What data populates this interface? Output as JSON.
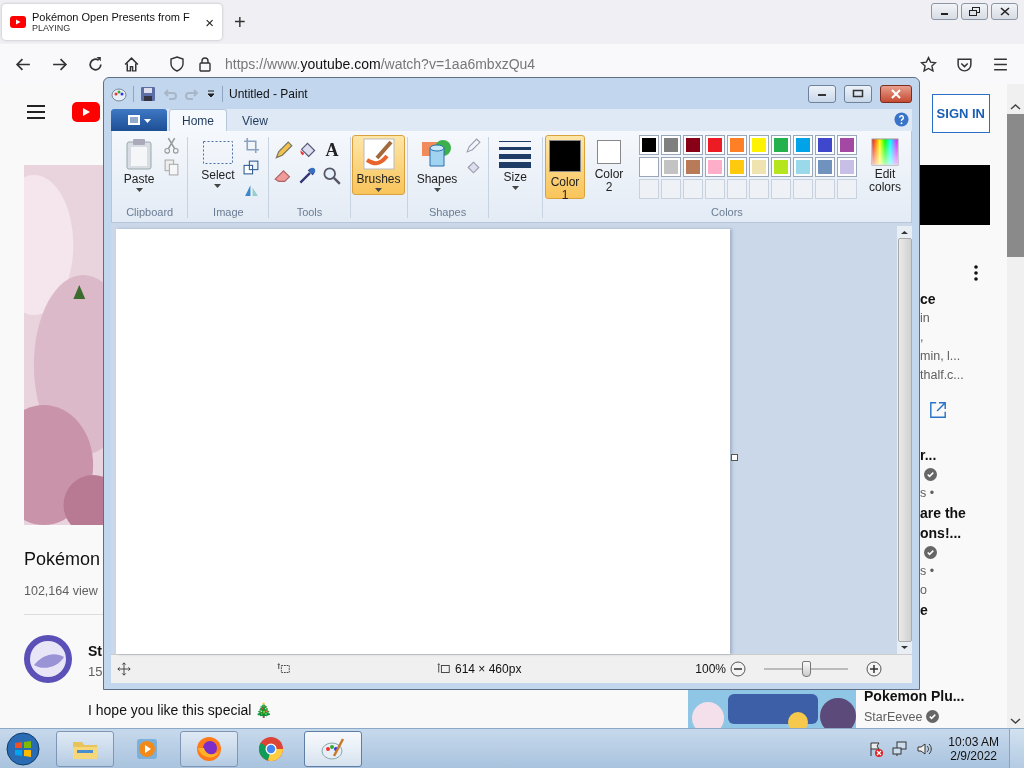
{
  "browser": {
    "tab": {
      "title": "Pokémon Open Presents from F",
      "status": "PLAYING",
      "close": "×"
    },
    "new_tab": "+",
    "url": {
      "scheme": "https://www.",
      "host": "youtube.com",
      "path": "/watch?v=1aa6mbxzQu4"
    }
  },
  "youtube": {
    "sign_in": "SIGN IN",
    "video_title": "Pokémon",
    "views": "102,164 view",
    "channel": "St",
    "subscribers": "15",
    "description": "I hope you like this special 🎄",
    "sidebar": [
      {
        "kind": "title",
        "text": "ce"
      },
      {
        "kind": "meta",
        "text": "in"
      },
      {
        "kind": "meta",
        "text": ","
      },
      {
        "kind": "meta",
        "text": "min, l..."
      },
      {
        "kind": "meta",
        "text": "thalf.c..."
      },
      {
        "kind": "link"
      },
      {
        "kind": "title",
        "text": "r..."
      },
      {
        "kind": "verified"
      },
      {
        "kind": "meta",
        "text": "s •"
      },
      {
        "kind": "title",
        "text": "are the"
      },
      {
        "kind": "title",
        "text": "ons!..."
      },
      {
        "kind": "verified"
      },
      {
        "kind": "meta",
        "text": "s •"
      },
      {
        "kind": "meta",
        "text": "o"
      },
      {
        "kind": "title",
        "text": "e"
      }
    ],
    "bottom_video": {
      "title": "Pokemon Plu...",
      "channel": "StarEevee"
    }
  },
  "paint": {
    "title": "Untitled - Paint",
    "tabs": [
      {
        "label": "Home",
        "selected": true
      },
      {
        "label": "View",
        "selected": false
      }
    ],
    "clipboard": {
      "label": "Clipboard",
      "paste": "Paste"
    },
    "image": {
      "label": "Image",
      "select": "Select"
    },
    "tools": {
      "label": "Tools",
      "text_tool": "A"
    },
    "brushes": {
      "label": "Brushes",
      "selected": true
    },
    "shapes": {
      "label": "Shapes",
      "button": "Shapes"
    },
    "size": {
      "button": "Size"
    },
    "colors": {
      "label": "Colors",
      "edit": "Edit colors",
      "current": [
        {
          "label": "Color 1",
          "color": "#000000",
          "selected": true
        },
        {
          "label": "Color 2",
          "color": "#ffffff",
          "selected": false
        }
      ],
      "palette": [
        {
          "color": "#000000"
        },
        {
          "color": "#7f7f7f"
        },
        {
          "color": "#880015"
        },
        {
          "color": "#ed1c24"
        },
        {
          "color": "#ff7f27"
        },
        {
          "color": "#fff200"
        },
        {
          "color": "#22b14c"
        },
        {
          "color": "#00a2e8"
        },
        {
          "color": "#3f48cc"
        },
        {
          "color": "#a349a4"
        },
        {
          "color": "#ffffff"
        },
        {
          "color": "#c3c3c3"
        },
        {
          "color": "#b97a57"
        },
        {
          "color": "#ffaec9"
        },
        {
          "color": "#ffc90e"
        },
        {
          "color": "#efe4b0"
        },
        {
          "color": "#b5e61d"
        },
        {
          "color": "#99d9ea"
        },
        {
          "color": "#7092be"
        },
        {
          "color": "#c8bfe7"
        }
      ]
    },
    "status": {
      "size": "614 × 460px",
      "zoom": "100%",
      "zoom_level": {
        "level": 0.5
      }
    }
  },
  "taskbar": {
    "items": [
      {
        "kind": "explorer",
        "running": true,
        "selected": false
      },
      {
        "kind": "media",
        "running": false,
        "selected": false
      },
      {
        "kind": "firefox",
        "running": true,
        "selected": false
      },
      {
        "kind": "chrome",
        "running": false,
        "selected": false
      },
      {
        "kind": "paint",
        "running": true,
        "selected": true
      }
    ],
    "time": "10:03 AM",
    "date": "2/9/2022"
  }
}
